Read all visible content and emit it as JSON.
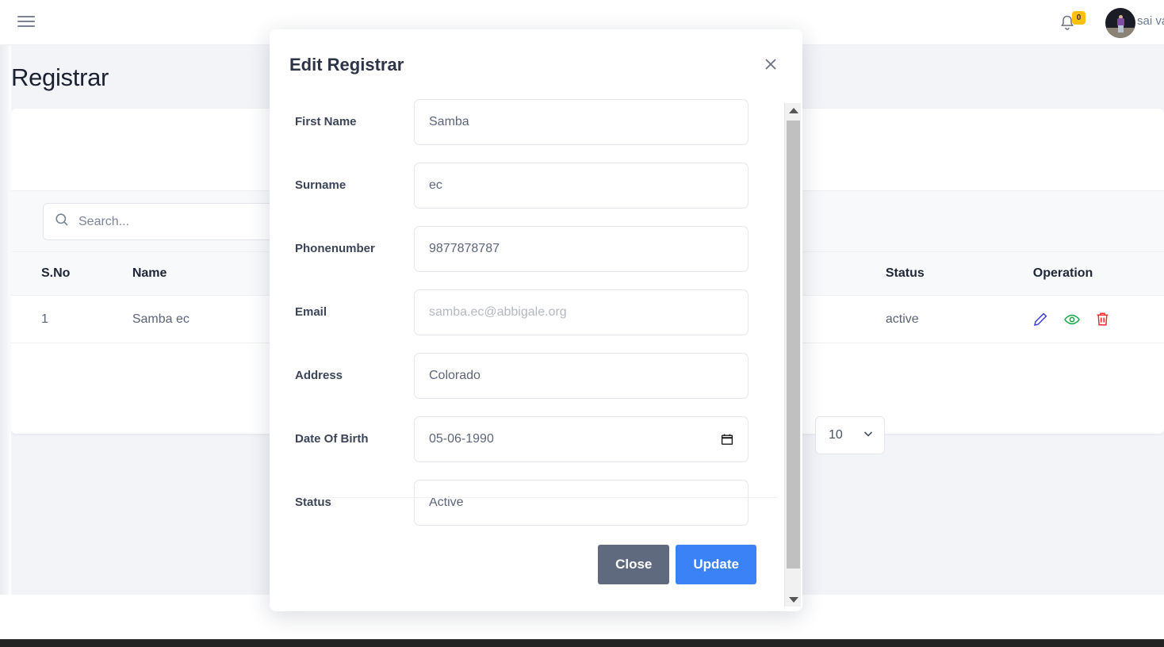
{
  "topbar": {
    "menu_icon": "hamburger-icon",
    "notification_icon": "bell-icon",
    "notification_count": "0",
    "notification_badge_color": "#ffc107",
    "username": "sai va"
  },
  "page": {
    "title": "Registrar"
  },
  "search": {
    "icon": "search-icon",
    "placeholder": "Search...",
    "value": ""
  },
  "table": {
    "columns": [
      "S.No",
      "Name",
      "",
      "Status",
      "Operation"
    ],
    "rows": [
      {
        "sno": "1",
        "name": "Samba ec",
        "mid": "",
        "status": "active",
        "operations": [
          "edit-pencil-icon",
          "view-eye-icon",
          "delete-trash-icon"
        ]
      }
    ],
    "operation_colors": {
      "edit": "#3b3fd8",
      "view": "#17a34a",
      "delete": "#ef2b2b"
    }
  },
  "pagination": {
    "per_page": "10",
    "chevron_icon": "chevron-down-icon"
  },
  "modal": {
    "title": "Edit Registrar",
    "close_icon": "close-icon",
    "fields": [
      {
        "label": "First Name",
        "value": "Samba",
        "placeholder": ""
      },
      {
        "label": "Surname",
        "value": "ec",
        "placeholder": ""
      },
      {
        "label": "Phonenumber",
        "value": "9877878787",
        "placeholder": ""
      },
      {
        "label": "Email",
        "value": "",
        "placeholder": "samba.ec@abbigale.org"
      },
      {
        "label": "Address",
        "value": "Colorado",
        "placeholder": ""
      },
      {
        "label": "Date Of Birth",
        "value": "05-06-1990",
        "placeholder": ""
      },
      {
        "label": "Status",
        "value": "Active",
        "placeholder": ""
      }
    ],
    "date_icon": "calendar-icon",
    "buttons": {
      "close": "Close",
      "update": "Update",
      "close_color": "#606a7f",
      "update_color": "#3b82f6"
    },
    "scrollbar": {
      "up_icon": "scroll-up-arrow-icon",
      "down_icon": "scroll-down-arrow-icon"
    }
  }
}
